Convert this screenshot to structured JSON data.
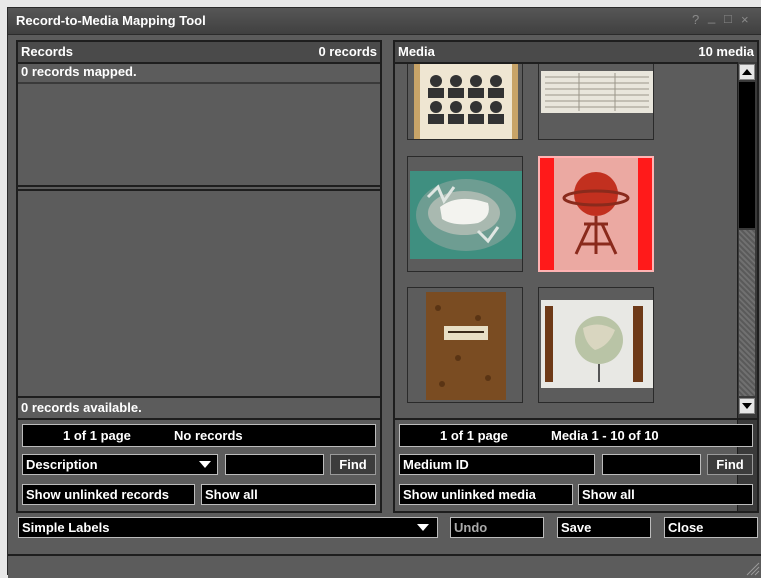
{
  "window": {
    "title": "Record-to-Media Mapping Tool",
    "help": "?",
    "minimize": "_",
    "maximize": "□",
    "close": "×"
  },
  "records": {
    "title": "Records",
    "count": "0 records",
    "mapped": "0 records mapped.",
    "available": "0 records available.",
    "page": "1 of 1 page",
    "range": "No records",
    "search_field": "Description",
    "search_value": "",
    "find": "Find",
    "show_unlinked": "Show unlinked records",
    "show_all": "Show all"
  },
  "media": {
    "title": "Media",
    "count": "10 media",
    "page": "1 of 1 page",
    "range": "Media 1 - 10 of 10",
    "search_field": "Medium ID",
    "search_value": "",
    "find": "Find",
    "show_unlinked": "Show unlinked media",
    "show_all": "Show all",
    "thumbnails": [
      {
        "name": "portrait-grid"
      },
      {
        "name": "newspaper-page"
      },
      {
        "name": "relief-map"
      },
      {
        "name": "terrestrial-globe",
        "selected": true
      },
      {
        "name": "leather-book"
      },
      {
        "name": "globe-case"
      }
    ]
  },
  "footer": {
    "label_mode": "Simple Labels",
    "undo": "Undo",
    "save": "Save",
    "close": "Close"
  },
  "colors": {
    "selected": "#ff1a1a",
    "panel": "#5c5c5c",
    "header": "#4a4a4a"
  }
}
